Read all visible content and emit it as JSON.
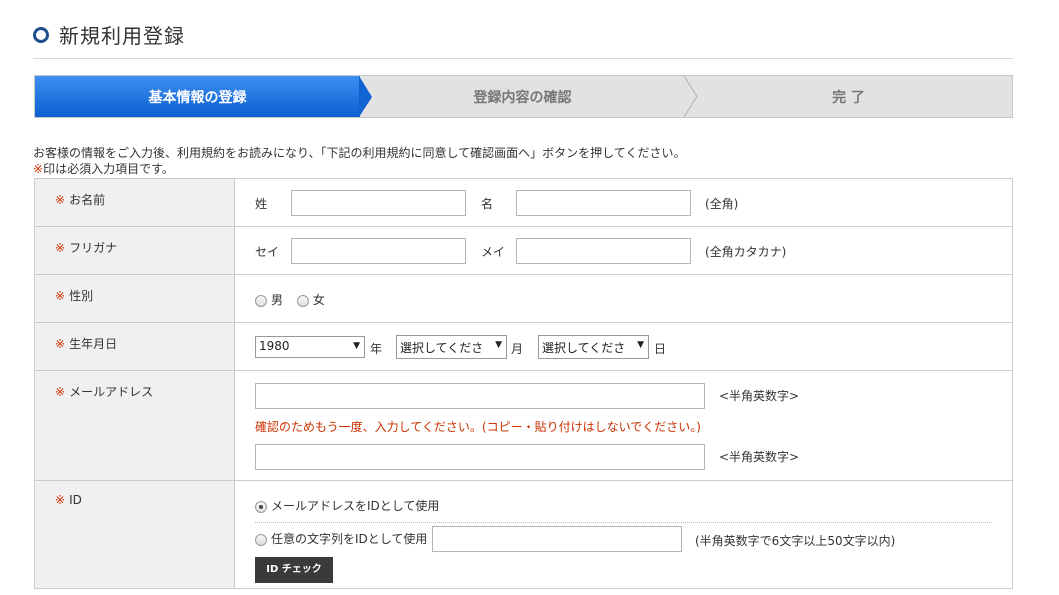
{
  "page": {
    "title": "新規利用登録"
  },
  "steps": [
    {
      "label": "基本情報の登録"
    },
    {
      "label": "登録内容の確認"
    },
    {
      "label": "完 了"
    }
  ],
  "intro": {
    "line1": "お客様の情報をご入力後、利用規約をお読みになり、「下記の利用規約に同意して確認画面へ」ボタンを押してください。",
    "req_mark": "※",
    "line2": "印は必須入力項目です。"
  },
  "form": {
    "required_mark": "※",
    "name": {
      "label": "お名前",
      "sei": "姓",
      "mei": "名",
      "hint": "(全角)"
    },
    "kana": {
      "label": "フリガナ",
      "sei": "セイ",
      "mei": "メイ",
      "hint": "(全角カタカナ)"
    },
    "gender": {
      "label": "性別",
      "male": "男",
      "female": "女"
    },
    "birth": {
      "label": "生年月日",
      "year_value": "1980",
      "year_unit": "年",
      "month_value": "選択してくださ",
      "month_unit": "月",
      "day_value": "選択してくださ",
      "day_unit": "日"
    },
    "email": {
      "label": "メールアドレス",
      "hint": "<半角英数字>",
      "confirm_note": "確認のためもう一度、入力してください。(コピー・貼り付けはしないでください。)",
      "hint2": "<半角英数字>"
    },
    "id": {
      "label": "ID",
      "option1": "メールアドレスをIDとして使用",
      "option2": "任意の文字列をIDとして使用",
      "hint": "(半角英数字で6文字以上50文字以内)",
      "check_button": "ID チェック"
    }
  }
}
